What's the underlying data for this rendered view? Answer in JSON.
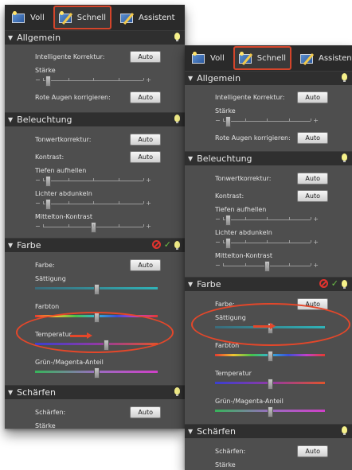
{
  "tabs": [
    {
      "label": "Voll"
    },
    {
      "label": "Schnell"
    },
    {
      "label": "Assistent"
    }
  ],
  "sections": {
    "allgemein": "Allgemein",
    "beleuchtung": "Beleuchtung",
    "farbe": "Farbe",
    "schaerfen": "Schärfen"
  },
  "labels": {
    "intelligente_korrektur": "Intelligente Korrektur:",
    "staerke": "Stärke",
    "rote_augen": "Rote Augen korrigieren:",
    "tonwertkorrektur": "Tonwertkorrektur:",
    "kontrast": "Kontrast:",
    "tiefen": "Tiefen aufhellen",
    "lichter": "Lichter abdunkeln",
    "mittelton": "Mittelton-Kontrast",
    "farbe": "Farbe:",
    "saettigung": "Sättigung",
    "farbton": "Farbton",
    "temperatur": "Temperatur",
    "gruen_magenta": "Grün-/Magenta-Anteil",
    "schaerfen": "Schärfen:"
  },
  "buttons": {
    "auto": "Auto"
  },
  "slider_symbols": {
    "minus": "−",
    "plus": "+"
  },
  "slider_values": {
    "staerke": 0.05,
    "tiefen": 0.05,
    "lichter": 0.05,
    "mittelton": 0.5,
    "saettigung": 0.5,
    "farbton": 0.5,
    "temperatur_a": 0.58,
    "temperatur_b": 0.5,
    "gruen_magenta": 0.5
  },
  "colors": {
    "panel_bg": "#4e4e4e",
    "header_bg": "#2f2f2f",
    "highlight": "#e4472a"
  }
}
